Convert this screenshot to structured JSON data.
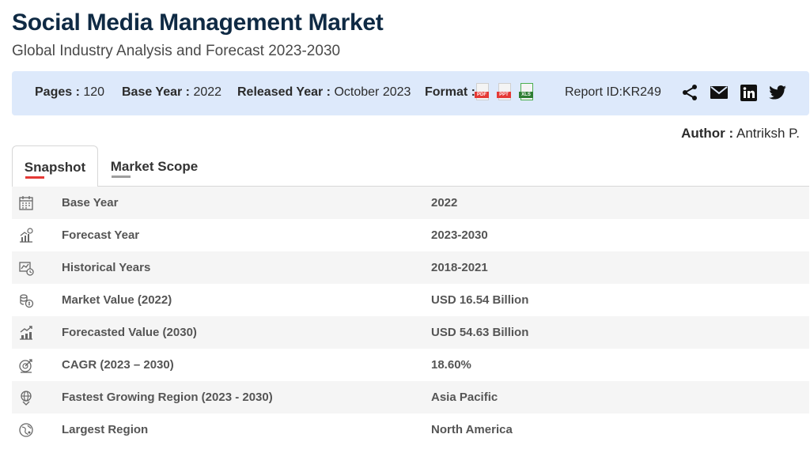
{
  "header": {
    "title": "Social Media Management Market",
    "subtitle": "Global Industry Analysis and Forecast 2023-2030"
  },
  "infobar": {
    "pages_label": "Pages :",
    "pages_value": "120",
    "base_year_label": "Base Year :",
    "base_year_value": "2022",
    "released_label": "Released Year :",
    "released_value": "October 2023",
    "format_label": "Format :",
    "formats": [
      {
        "tag": "PDF",
        "color": "#e53935",
        "icon": "pdf-file-icon"
      },
      {
        "tag": "PPT",
        "color": "#e53935",
        "icon": "ppt-file-icon"
      },
      {
        "tag": "XLS",
        "color": "#2e7d32",
        "icon": "excel-file-icon"
      }
    ],
    "report_id": "Report ID:KR249",
    "share_icons": [
      "share-icon",
      "email-icon",
      "linkedin-icon",
      "twitter-icon"
    ]
  },
  "author": {
    "label": "Author :",
    "name": "Antriksh P."
  },
  "tabs": [
    {
      "label": "Snapshot",
      "active": true,
      "underline_color": "#e53935"
    },
    {
      "label": "Market Scope",
      "active": false,
      "underline_color": "#9e9e9e"
    }
  ],
  "snapshot_rows": [
    {
      "icon": "calendar-icon",
      "label": "Base Year",
      "value": "2022"
    },
    {
      "icon": "growth-chart-icon",
      "label": "Forecast Year",
      "value": "2023-2030"
    },
    {
      "icon": "history-chart-icon",
      "label": "Historical Years",
      "value": "2018-2021"
    },
    {
      "icon": "money-stack-icon",
      "label": "Market Value (2022)",
      "value": "USD 16.54 Billion"
    },
    {
      "icon": "forecast-value-icon",
      "label": "Forecasted Value (2030)",
      "value": "USD 54.63 Billion"
    },
    {
      "icon": "cagr-icon",
      "label": "CAGR (2023 – 2030)",
      "value": "18.60%"
    },
    {
      "icon": "globe-growth-icon",
      "label": "Fastest Growing Region (2023 - 2030)",
      "value": "Asia Pacific"
    },
    {
      "icon": "globe-region-icon",
      "label": "Largest Region",
      "value": "North America"
    }
  ],
  "colors": {
    "title": "#0f2a44",
    "infobar_bg": "#dde9fb",
    "accent_red": "#e53935"
  }
}
